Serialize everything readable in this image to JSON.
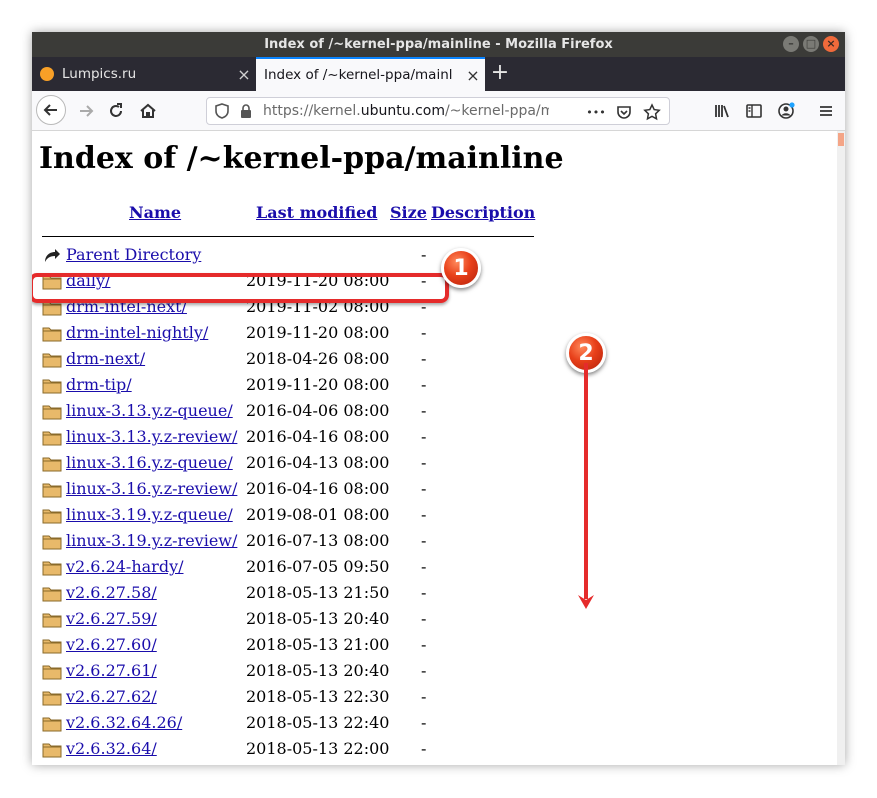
{
  "window": {
    "title": "Index of /~kernel-ppa/mainline - Mozilla Firefox",
    "controls": [
      "–",
      "□",
      "×"
    ]
  },
  "tabs": [
    {
      "title": "Lumpics.ru",
      "active": false,
      "close": "×"
    },
    {
      "title": "Index of /~kernel-ppa/mainl",
      "active": true,
      "close": "×"
    }
  ],
  "new_tab": "+",
  "toolbar": {
    "url_prefix": "https://kernel.",
    "url_host": "ubuntu.com",
    "url_rest": "/~kernel-ppa/m",
    "more": "•••"
  },
  "page": {
    "title": "Index of /~kernel-ppa/mainline",
    "columns": {
      "name": "Name",
      "last_modified": "Last modified",
      "size": "Size",
      "description": "Description"
    },
    "rows": [
      {
        "name": "Parent Directory",
        "date": "",
        "size": "-",
        "icon": "back-icon"
      },
      {
        "name": "daily/",
        "date": "2019-11-20 08:00",
        "size": "-",
        "icon": "folder-icon"
      },
      {
        "name": "drm-intel-next/",
        "date": "2019-11-02 08:00",
        "size": "-",
        "icon": "folder-icon"
      },
      {
        "name": "drm-intel-nightly/",
        "date": "2019-11-20 08:00",
        "size": "-",
        "icon": "folder-icon"
      },
      {
        "name": "drm-next/",
        "date": "2018-04-26 08:00",
        "size": "-",
        "icon": "folder-icon"
      },
      {
        "name": "drm-tip/",
        "date": "2019-11-20 08:00",
        "size": "-",
        "icon": "folder-icon"
      },
      {
        "name": "linux-3.13.y.z-queue/",
        "date": "2016-04-06 08:00",
        "size": "-",
        "icon": "folder-icon"
      },
      {
        "name": "linux-3.13.y.z-review/",
        "date": "2016-04-16 08:00",
        "size": "-",
        "icon": "folder-icon"
      },
      {
        "name": "linux-3.16.y.z-queue/",
        "date": "2016-04-13 08:00",
        "size": "-",
        "icon": "folder-icon"
      },
      {
        "name": "linux-3.16.y.z-review/",
        "date": "2016-04-16 08:00",
        "size": "-",
        "icon": "folder-icon"
      },
      {
        "name": "linux-3.19.y.z-queue/",
        "date": "2019-08-01 08:00",
        "size": "-",
        "icon": "folder-icon"
      },
      {
        "name": "linux-3.19.y.z-review/",
        "date": "2016-07-13 08:00",
        "size": "-",
        "icon": "folder-icon"
      },
      {
        "name": "v2.6.24-hardy/",
        "date": "2016-07-05 09:50",
        "size": "-",
        "icon": "folder-icon"
      },
      {
        "name": "v2.6.27.58/",
        "date": "2018-05-13 21:50",
        "size": "-",
        "icon": "folder-icon"
      },
      {
        "name": "v2.6.27.59/",
        "date": "2018-05-13 20:40",
        "size": "-",
        "icon": "folder-icon"
      },
      {
        "name": "v2.6.27.60/",
        "date": "2018-05-13 21:00",
        "size": "-",
        "icon": "folder-icon"
      },
      {
        "name": "v2.6.27.61/",
        "date": "2018-05-13 20:40",
        "size": "-",
        "icon": "folder-icon"
      },
      {
        "name": "v2.6.27.62/",
        "date": "2018-05-13 22:30",
        "size": "-",
        "icon": "folder-icon"
      },
      {
        "name": "v2.6.32.64.26/",
        "date": "2018-05-13 22:40",
        "size": "-",
        "icon": "folder-icon"
      },
      {
        "name": "v2.6.32.64/",
        "date": "2018-05-13 22:00",
        "size": "-",
        "icon": "folder-icon"
      }
    ]
  },
  "annotations": {
    "badge_1": "1",
    "badge_2": "2",
    "accent_color": "#e52b2b"
  }
}
